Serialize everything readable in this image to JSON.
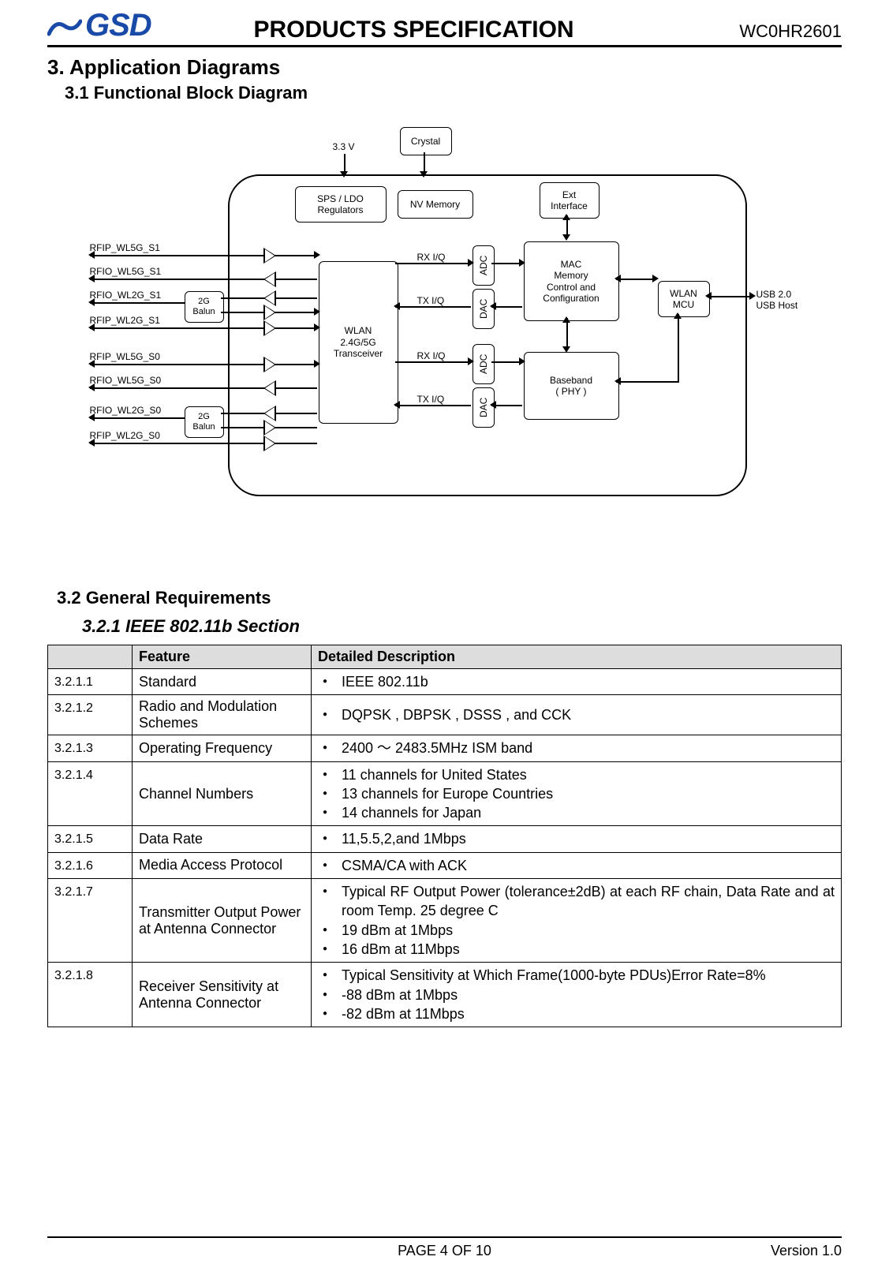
{
  "header": {
    "logo": "GSD",
    "title": "PRODUCTS SPECIFICATION",
    "part": "WC0HR2601"
  },
  "sections": {
    "s3": "3.  Application Diagrams",
    "s31": "3.1 Functional Block Diagram",
    "s32": "3.2 General Requirements",
    "s321": "3.2.1 IEEE 802.11b Section"
  },
  "diagram": {
    "v33": "3.3 V",
    "crystal": "Crystal",
    "sps": "SPS / LDO\nRegulators",
    "nvm": "NV Memory",
    "ext": "Ext\nInterface",
    "mac": "MAC\nMemory\nControl and\nConfiguration",
    "bb": "Baseband\n( PHY )",
    "wlanmcu": "WLAN\nMCU",
    "usb": "USB 2.0\nUSB Host",
    "xcvr": "WLAN\n2.4G/5G\nTransceiver",
    "adc": "ADC",
    "dac": "DAC",
    "balun": "2G\nBalun",
    "rxiq": "RX I/Q",
    "txiq": "TX I/Q",
    "rf": {
      "a": "RFIP_WL5G_S1",
      "b": "RFIO_WL5G_S1",
      "c": "RFIO_WL2G_S1",
      "d": "RFIP_WL2G_S1",
      "e": "RFIP_WL5G_S0",
      "f": "RFIO_WL5G_S0",
      "g": "RFIO_WL2G_S0",
      "h": "RFIP_WL2G_S0"
    }
  },
  "table": {
    "h1": "Feature",
    "h2": "Detailed Description",
    "rows": [
      {
        "id": "3.2.1.1",
        "f": "Standard",
        "d": [
          "IEEE 802.11b"
        ]
      },
      {
        "id": "3.2.1.2",
        "f": "Radio and Modulation Schemes",
        "d": [
          "DQPSK , DBPSK , DSSS , and CCK"
        ]
      },
      {
        "id": "3.2.1.3",
        "f": "Operating Frequency",
        "d": [
          "2400  ～  2483.5MHz ISM band"
        ]
      },
      {
        "id": "3.2.1.4",
        "f": "Channel Numbers",
        "d": [
          "11 channels for United States",
          "13 channels for Europe Countries",
          "14 channels for Japan"
        ]
      },
      {
        "id": "3.2.1.5",
        "f": "Data Rate",
        "d": [
          "11,5.5,2,and 1Mbps"
        ]
      },
      {
        "id": "3.2.1.6",
        "f": "Media Access Protocol",
        "d": [
          "CSMA/CA with ACK"
        ]
      },
      {
        "id": "3.2.1.7",
        "f": "Transmitter Output Power at Antenna Connector",
        "d": [
          "Typical RF Output Power (tolerance±2dB) at each RF chain, Data Rate and at room Temp. 25 degree C",
          "19 dBm at 1Mbps",
          "16 dBm at 11Mbps"
        ]
      },
      {
        "id": "3.2.1.8",
        "f": "Receiver Sensitivity at Antenna Connector",
        "d": [
          "Typical Sensitivity at Which Frame(1000-byte PDUs)Error Rate=8%",
          "-88 dBm at 1Mbps",
          "-82 dBm at 11Mbps"
        ]
      }
    ]
  },
  "footer": {
    "page": "PAGE    4    OF    10",
    "ver": "Version  1.0"
  }
}
